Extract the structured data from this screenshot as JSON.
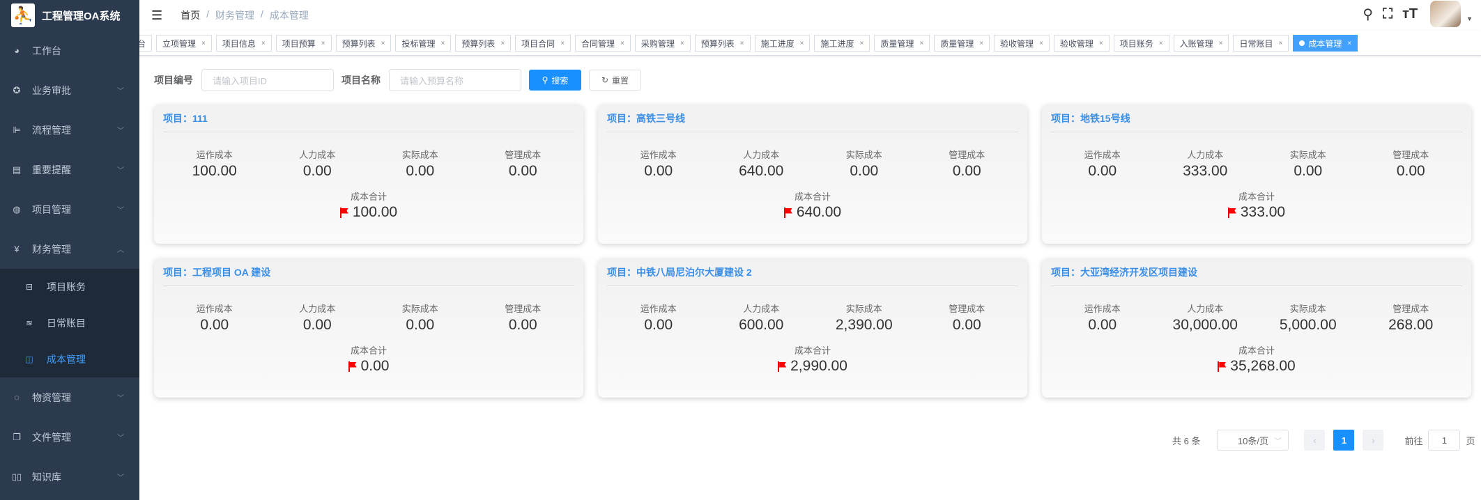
{
  "app": {
    "title": "工程管理OA系统"
  },
  "sidebar": {
    "items": [
      {
        "label": "工作台",
        "icon": "dashboard-icon"
      },
      {
        "label": "业务审批",
        "icon": "approval-icon"
      },
      {
        "label": "流程管理",
        "icon": "flow-icon"
      },
      {
        "label": "重要提醒",
        "icon": "calendar-icon"
      },
      {
        "label": "项目管理",
        "icon": "globe-icon"
      },
      {
        "label": "财务管理",
        "icon": "yen-icon"
      }
    ],
    "finance_sub": [
      {
        "label": "项目账务",
        "icon": "briefcase-icon"
      },
      {
        "label": "日常账目",
        "icon": "layers-icon"
      },
      {
        "label": "成本管理",
        "icon": "book-icon",
        "active": true
      }
    ],
    "items_after": [
      {
        "label": "物资管理",
        "icon": "palette-icon"
      },
      {
        "label": "文件管理",
        "icon": "files-icon"
      },
      {
        "label": "知识库",
        "icon": "book-open-icon"
      }
    ]
  },
  "breadcrumb": [
    "首页",
    "财务管理",
    "成本管理"
  ],
  "tags": [
    "工作台",
    "立项管理",
    "项目信息",
    "项目预算",
    "预算列表",
    "投标管理",
    "预算列表",
    "项目合同",
    "合同管理",
    "采购管理",
    "预算列表",
    "施工进度",
    "施工进度",
    "质量管理",
    "质量管理",
    "验收管理",
    "验收管理",
    "项目账务",
    "入账管理",
    "日常账目",
    "成本管理"
  ],
  "search": {
    "id_label": "项目编号",
    "id_placeholder": "请输入项目ID",
    "name_label": "项目名称",
    "name_placeholder": "请输入预算名称",
    "search_btn": "搜索",
    "reset_btn": "重置"
  },
  "card_labels": {
    "op": "运作成本",
    "labor": "人力成本",
    "actual": "实际成本",
    "mgmt": "管理成本",
    "total": "成本合计"
  },
  "cards": [
    {
      "title": "项目：111",
      "op": "100.00",
      "labor": "0.00",
      "actual": "0.00",
      "mgmt": "0.00",
      "total": "100.00"
    },
    {
      "title": "项目：高铁三号线",
      "op": "0.00",
      "labor": "640.00",
      "actual": "0.00",
      "mgmt": "0.00",
      "total": "640.00"
    },
    {
      "title": "项目：地铁15号线",
      "op": "0.00",
      "labor": "333.00",
      "actual": "0.00",
      "mgmt": "0.00",
      "total": "333.00"
    },
    {
      "title": "项目：工程项目 OA 建设",
      "op": "0.00",
      "labor": "0.00",
      "actual": "0.00",
      "mgmt": "0.00",
      "total": "0.00"
    },
    {
      "title": "项目：中铁八局尼泊尔大厦建设 2",
      "op": "0.00",
      "labor": "600.00",
      "actual": "2,390.00",
      "mgmt": "0.00",
      "total": "2,990.00"
    },
    {
      "title": "项目：大亚湾经济开发区项目建设",
      "op": "0.00",
      "labor": "30,000.00",
      "actual": "5,000.00",
      "mgmt": "268.00",
      "total": "35,268.00"
    }
  ],
  "pagination": {
    "total": "共 6 条",
    "page_size": "10条/页",
    "current": "1",
    "goto_label": "前往",
    "goto_value": "1",
    "page_suffix": "页"
  }
}
